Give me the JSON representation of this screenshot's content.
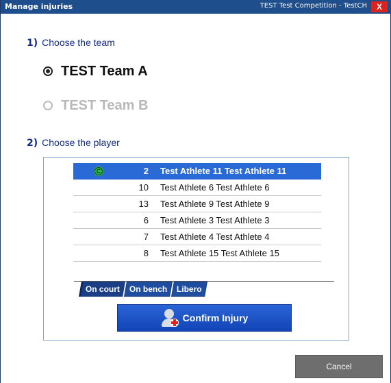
{
  "window": {
    "title": "Manage injuries",
    "subtitle": "TEST  Test Competition - TestCH",
    "close_label": "X"
  },
  "step1": {
    "number": "1)",
    "label": "Choose the team"
  },
  "teams": [
    {
      "label": "TEST Team A",
      "selected": true,
      "enabled": true
    },
    {
      "label": "TEST Team B",
      "selected": false,
      "enabled": false
    }
  ],
  "step2": {
    "number": "2)",
    "label": "Choose the player"
  },
  "players": [
    {
      "number": "2",
      "name": "Test Athlete 11 Test Athlete 11",
      "captain": true,
      "selected": true
    },
    {
      "number": "10",
      "name": "Test Athlete 6 Test Athlete 6",
      "captain": false,
      "selected": false
    },
    {
      "number": "13",
      "name": "Test Athlete 9 Test Athlete 9",
      "captain": false,
      "selected": false
    },
    {
      "number": "6",
      "name": "Test Athlete 3 Test Athlete 3",
      "captain": false,
      "selected": false
    },
    {
      "number": "7",
      "name": "Test Athlete 4 Test Athlete 4",
      "captain": false,
      "selected": false
    },
    {
      "number": "8",
      "name": "Test Athlete 15 Test Athlete 15",
      "captain": false,
      "selected": false
    }
  ],
  "captain_badge": "C",
  "tabs": [
    {
      "label": "On court",
      "active": true
    },
    {
      "label": "On bench",
      "active": false
    },
    {
      "label": "Libero",
      "active": false
    }
  ],
  "confirm_button": {
    "label": "Confirm Injury",
    "icon": "user-add-injury-icon"
  },
  "cancel_button": {
    "label": "Cancel"
  },
  "colors": {
    "titlebar": "#1f4e8c",
    "accent_blue": "#2a6ad6",
    "step_text": "#102a86",
    "close_red": "#d9251d",
    "captain_green": "#2fbf4a",
    "cancel_gray": "#6e6e6e"
  }
}
